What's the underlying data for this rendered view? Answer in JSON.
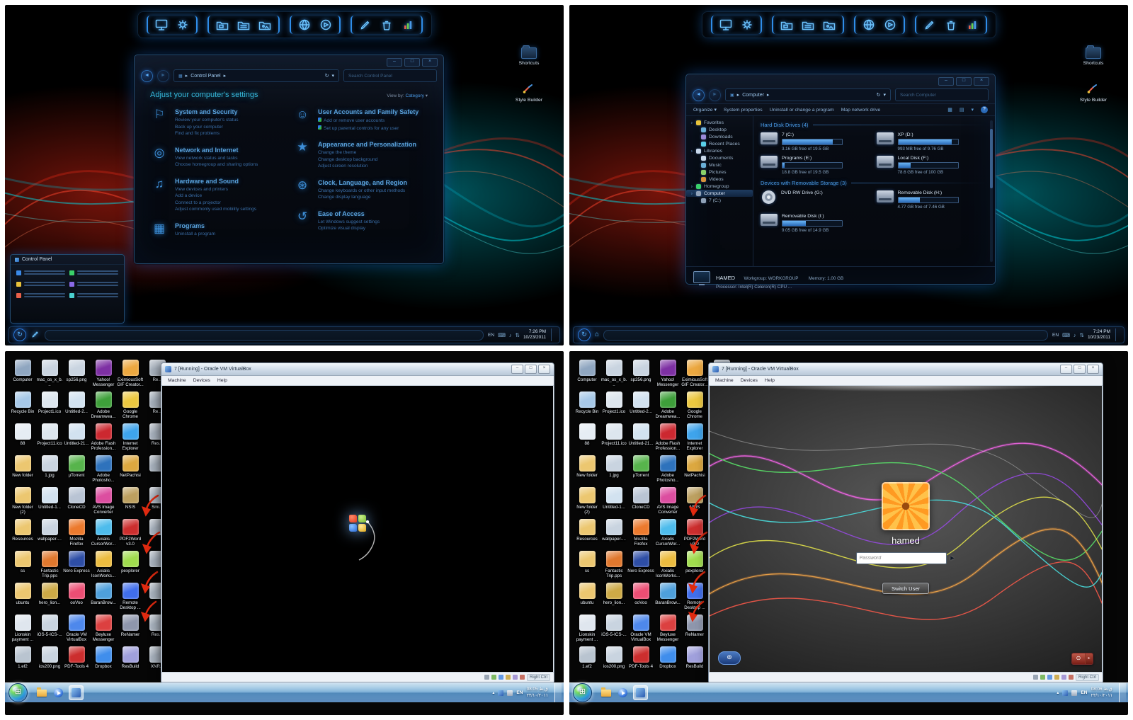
{
  "theme": {
    "accent_blue": "#4aa0e8",
    "neon_glow": "#2a8ae8",
    "taskbar_aero": "#7ab8e4",
    "desktop_bg": "#060606"
  },
  "glyphs": {
    "min": "–",
    "max": "□",
    "close": "×",
    "back": "◄",
    "fwd": "►",
    "crumb": "▸",
    "caret": "▾",
    "refresh": "↻",
    "cp": "▦",
    "computer": "▣",
    "keyboard": "⌨",
    "volume": "♪",
    "network": "⇅",
    "swirl": "↻",
    "win": "⊞",
    "views": "▦",
    "list": "▤",
    "help": "?",
    "up": "▴",
    "go": "►",
    "power": "⊙",
    "power_more": "▸",
    "access": "⊚"
  },
  "labels": {
    "shortcuts": "Shortcuts",
    "style_builder": "Style Builder",
    "preview_title": "Control Panel"
  },
  "panels": {
    "tl": {
      "lang": "EN",
      "time": "7:26 PM",
      "date": "10/23/2011"
    },
    "tr": {
      "lang": "EN",
      "time": "7:24 PM",
      "date": "10/23/2011"
    },
    "bl": {
      "lang": "EN",
      "time": "08:05 ق.ظ",
      "date": "٢٣/١٠/٢٠١١"
    },
    "br": {
      "lang": "EN",
      "time": "08:06 ق.ظ",
      "date": "٢٣/١٠/٢٠١١"
    }
  },
  "control_panel": {
    "address": "Control Panel",
    "search_placeholder": "Search Control Panel",
    "header": "Adjust your computer's settings",
    "view_by": "View by:",
    "view_value": "Category",
    "cats_left": [
      {
        "g": "⚐",
        "title": "System and Security",
        "links": [
          {
            "cls": "cp-link",
            "t": "Review your computer's status"
          },
          {
            "cls": "cp-link",
            "t": "Back up your computer"
          },
          {
            "cls": "cp-link",
            "t": "Find and fix problems"
          }
        ]
      },
      {
        "g": "◎",
        "title": "Network and Internet",
        "links": [
          {
            "cls": "cp-link",
            "t": "View network status and tasks"
          },
          {
            "cls": "cp-link",
            "t": "Choose homegroup and sharing options"
          }
        ]
      },
      {
        "g": "♫",
        "title": "Hardware and Sound",
        "links": [
          {
            "cls": "cp-link",
            "t": "View devices and printers"
          },
          {
            "cls": "cp-link",
            "t": "Add a device"
          },
          {
            "cls": "cp-link",
            "t": "Connect to a projector"
          },
          {
            "cls": "cp-link",
            "t": "Adjust commonly used mobility settings"
          }
        ]
      },
      {
        "g": "▦",
        "title": "Programs",
        "links": [
          {
            "cls": "cp-link",
            "t": "Uninstall a program"
          }
        ]
      }
    ],
    "cats_right": [
      {
        "g": "☺",
        "title": "User Accounts and Family Safety",
        "links": [
          {
            "cls": "cp-link shield",
            "t": "Add or remove user accounts"
          },
          {
            "cls": "cp-link shield",
            "t": "Set up parental controls for any user"
          }
        ]
      },
      {
        "g": "★",
        "title": "Appearance and Personalization",
        "links": [
          {
            "cls": "cp-link",
            "t": "Change the theme"
          },
          {
            "cls": "cp-link",
            "t": "Change desktop background"
          },
          {
            "cls": "cp-link",
            "t": "Adjust screen resolution"
          }
        ]
      },
      {
        "g": "⊛",
        "title": "Clock, Language, and Region",
        "links": [
          {
            "cls": "cp-link",
            "t": "Change keyboards or other input methods"
          },
          {
            "cls": "cp-link",
            "t": "Change display language"
          }
        ]
      },
      {
        "g": "↺",
        "title": "Ease of Access",
        "links": [
          {
            "cls": "cp-link",
            "t": "Let Windows suggest settings"
          },
          {
            "cls": "cp-link",
            "t": "Optimize visual display"
          }
        ]
      }
    ]
  },
  "computer_win": {
    "address": "Computer",
    "search_placeholder": "Search Computer",
    "toolbar": [
      "Organize ▾",
      "System properties",
      "Uninstall or change a program",
      "Map network drive"
    ],
    "sidebar": [
      {
        "cls": "sb-item lvl1",
        "l": "Favorites",
        "c": "#e8c23a"
      },
      {
        "cls": "sb-item lvl2",
        "l": "Desktop",
        "c": "#6ab0d8"
      },
      {
        "cls": "sb-item lvl2",
        "l": "Downloads",
        "c": "#9a8ad8"
      },
      {
        "cls": "sb-item lvl2",
        "l": "Recent Places",
        "c": "#5ad0e8"
      },
      {
        "cls": "sb-item lvl1",
        "l": "Libraries",
        "c": "#c8d8ea"
      },
      {
        "cls": "sb-item lvl2",
        "l": "Documents",
        "c": "#c8d8ea"
      },
      {
        "cls": "sb-item lvl2",
        "l": "Music",
        "c": "#6ab0d8"
      },
      {
        "cls": "sb-item lvl2",
        "l": "Pictures",
        "c": "#8ad06a"
      },
      {
        "cls": "sb-item lvl2",
        "l": "Videos",
        "c": "#d8923a"
      },
      {
        "cls": "sb-item lvl1",
        "l": "Homegroup",
        "c": "#3ad06a"
      },
      {
        "cls": "sb-item lvl1 sel",
        "l": "Computer",
        "c": "#90a2b8"
      },
      {
        "cls": "sb-item lvl2",
        "l": "7 (C:)",
        "c": "#90a2b8"
      }
    ],
    "sections": [
      {
        "title": "Hard Disk Drives (4)",
        "drives": [
          {
            "cls": "drv",
            "name": "7 (C:)",
            "w": "84%",
            "info": "3.16 GB free of 19.5 GB"
          },
          {
            "cls": "drv",
            "name": "XP (D:)",
            "w": "90%",
            "info": "993 MB free of 9.76 GB"
          },
          {
            "cls": "drv",
            "name": "Programs (E:)",
            "w": "4%",
            "info": "18.8 GB free of 19.5 GB"
          },
          {
            "cls": "drv",
            "name": "Local Disk (F:)",
            "w": "21%",
            "info": "78.6 GB free of 100 GB"
          }
        ]
      },
      {
        "title": "Devices with Removable Storage (3)",
        "drives": [
          {
            "cls": "drv dvd",
            "name": "DVD RW Drive (G:)",
            "w": "0%",
            "info": ""
          },
          {
            "cls": "drv",
            "name": "Removable Disk (H:)",
            "w": "36%",
            "info": "4.77 GB free of 7.46 GB"
          },
          {
            "cls": "drv",
            "name": "Removable Disk (I:)",
            "w": "39%",
            "info": "9.05 GB free of 14.9 GB"
          }
        ]
      }
    ],
    "details": {
      "name": "HAMED",
      "workgroup": "Workgroup: WORKGROUP",
      "memory": "Memory: 1.00 GB",
      "processor": "Processor: Intel(R) Celeron(R) CPU ..."
    }
  },
  "vbox": {
    "title": "7 [Running] - Oracle VM VirtualBox",
    "menus": [
      "Machine",
      "Devices",
      "Help"
    ],
    "host_key": "Right Ctrl"
  },
  "login": {
    "user": "hamed",
    "password_placeholder": "Password",
    "switch_user": "Switch User"
  },
  "desktop": {
    "icons": [
      {
        "l": "Computer",
        "c": "#8fa6c0"
      },
      {
        "l": "Recycle Bin",
        "c": "#a6c8e8"
      },
      {
        "l": "88",
        "c": "#e6edf4"
      },
      {
        "l": "New folder",
        "c": "#ecc770"
      },
      {
        "l": "New folder (2)",
        "c": "#ecc770"
      },
      {
        "l": "Resources",
        "c": "#ecc770"
      },
      {
        "l": "ss",
        "c": "#ecc770"
      },
      {
        "l": "ubuntu",
        "c": "#ecc770"
      },
      {
        "l": "Lionskin payment ...",
        "c": "#dfe6ee"
      },
      {
        "l": "1.ef2",
        "c": "#b9c4d0"
      },
      {
        "l": "mac_os_x_b...",
        "c": "#c9d4e0"
      },
      {
        "l": "Project1.ico",
        "c": "#dde6ee"
      },
      {
        "l": "Project11.ico",
        "c": "#dde6ee"
      },
      {
        "l": "1.jpg",
        "c": "#c9d4e0"
      },
      {
        "l": "Untitled-1...",
        "c": "#d2e2f0"
      },
      {
        "l": "wallpaper-...",
        "c": "#c9d4e0"
      },
      {
        "l": "Fantastic Trip.pps",
        "c": "#e0782e"
      },
      {
        "l": "hero_lion...",
        "c": "#cdaa46"
      },
      {
        "l": "iOS-5-ICS-...",
        "c": "#c9d4e0"
      },
      {
        "l": "ios200.png",
        "c": "#c9d4e0"
      },
      {
        "l": "sp256.png",
        "c": "#c9d4e0"
      },
      {
        "l": "Untitled-2...",
        "c": "#d2e2f0"
      },
      {
        "l": "Untitled-21...",
        "c": "#d2e2f0"
      },
      {
        "l": "µTorrent",
        "c": "#57b44c"
      },
      {
        "l": "CloneCD",
        "c": "#b9c4d4"
      },
      {
        "l": "Mozilla Firefox",
        "c": "#ec7a2e"
      },
      {
        "l": "Nero Express",
        "c": "#2e4ea6"
      },
      {
        "l": "ooVoo",
        "c": "#ec4e74"
      },
      {
        "l": "Oracle VM VirtualBox",
        "c": "#4e88ec"
      },
      {
        "l": "PDF-Tools 4",
        "c": "#cc2e2e"
      },
      {
        "l": "Yahoo! Messenger",
        "c": "#7e30a4"
      },
      {
        "l": "Adobe Dreamwea...",
        "c": "#3ea03a"
      },
      {
        "l": "Adobe Flash Profession...",
        "c": "#cc2830"
      },
      {
        "l": "Adobe Photosho...",
        "c": "#2e72bc"
      },
      {
        "l": "AVS Image Converter",
        "c": "#dc4ea0"
      },
      {
        "l": "Axialis CursorWor...",
        "c": "#4ebcec"
      },
      {
        "l": "Axialis IconWorks...",
        "c": "#ecbc40"
      },
      {
        "l": "BaranBrow...",
        "c": "#4ea0dc"
      },
      {
        "l": "Beyluxe Messenger",
        "c": "#dc4040"
      },
      {
        "l": "Dropbox",
        "c": "#408eec"
      },
      {
        "l": "EximiousSoft GIF Creator...",
        "c": "#eca840"
      },
      {
        "l": "Google Chrome",
        "c": "#ecc840"
      },
      {
        "l": "Internet Explorer",
        "c": "#3ea4ec"
      },
      {
        "l": "NetPachisi",
        "c": "#dca840"
      },
      {
        "l": "NSIS",
        "c": "#bca060"
      },
      {
        "l": "PDF2Word v3.0",
        "c": "#cc2e2e"
      },
      {
        "l": "pexplorer",
        "c": "#a0dc4e"
      },
      {
        "l": "Remote Desktop ...",
        "c": "#406eec"
      },
      {
        "l": "ReNamer",
        "c": "#8e96ac"
      },
      {
        "l": "ResBuild",
        "c": "#a0a0dc"
      },
      {
        "l": "Re...",
        "c": "#aab4c0"
      },
      {
        "l": "Re...",
        "c": "#aab4c0"
      },
      {
        "l": "Res...",
        "c": "#aab4c0"
      },
      {
        "l": "",
        "c": "#aab4c0"
      },
      {
        "l": "Smi...",
        "c": "#aab4c0"
      },
      {
        "l": "",
        "c": "#aab4c0"
      },
      {
        "l": "",
        "c": "#aab4c0"
      },
      {
        "l": "",
        "c": "#aab4c0"
      },
      {
        "l": "Res...",
        "c": "#aab4c0"
      },
      {
        "l": "XNR...",
        "c": "#aab4c0"
      }
    ]
  }
}
